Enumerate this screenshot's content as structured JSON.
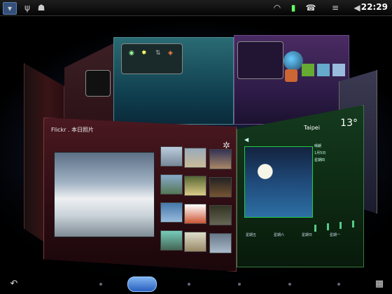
{
  "status_bar": {
    "icons": [
      "menu-icon",
      "usb-icon",
      "android-debug-icon",
      "wifi-icon",
      "battery-icon",
      "phone-icon",
      "notification-icon",
      "volume-icon"
    ],
    "time": "22:29"
  },
  "photo_panel": {
    "title": "Flickr . 本日照片"
  },
  "weather_panel": {
    "city": "Taipei",
    "temperature": "13°",
    "now_label": "晴朗",
    "date": "1月5日",
    "weekday": "星期四",
    "forecast_days": [
      "星期五",
      "星期六",
      "星期日",
      "星期一"
    ]
  },
  "colors": {
    "accent": "#2a5fbf",
    "photo_panel": "#4a1820",
    "weather_panel": "#143a1e",
    "teal_panel": "#2a6b74",
    "purple_panel": "#4a2b63"
  }
}
